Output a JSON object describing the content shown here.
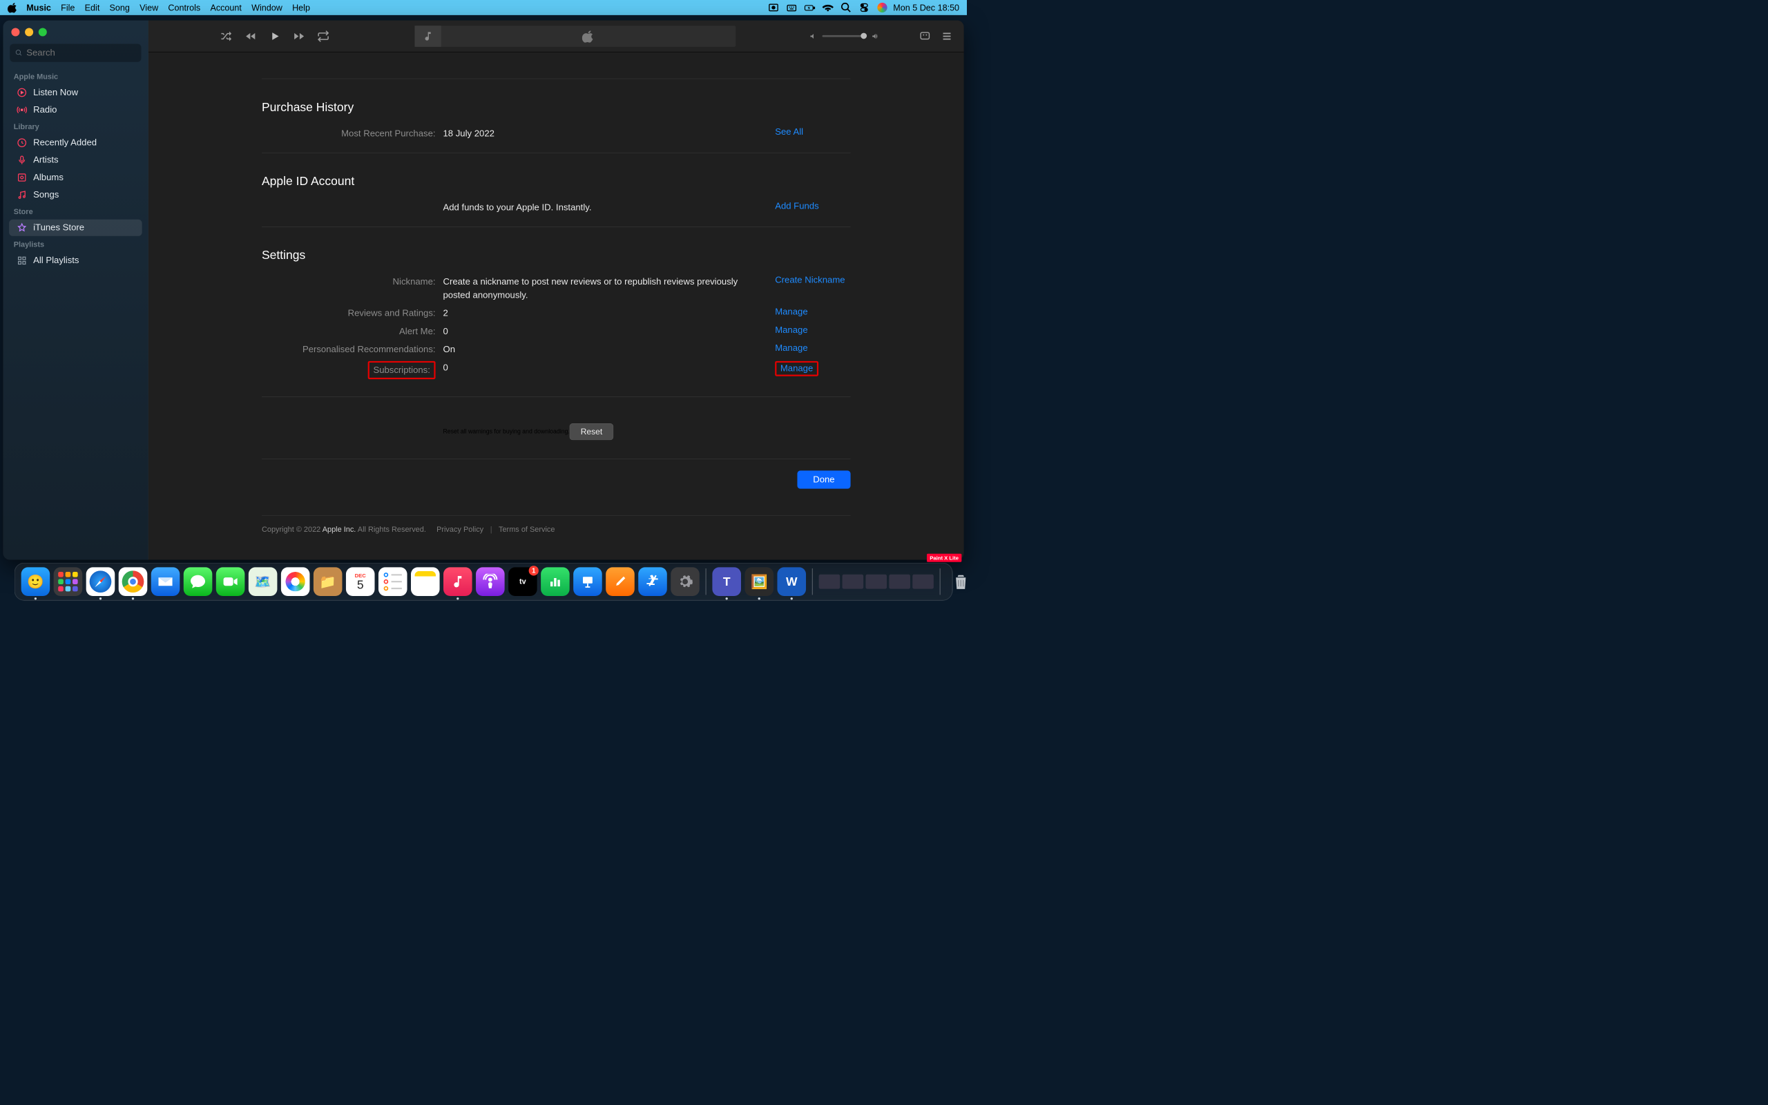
{
  "menubar": {
    "app": "Music",
    "items": [
      "File",
      "Edit",
      "Song",
      "View",
      "Controls",
      "Account",
      "Window",
      "Help"
    ],
    "datetime": "Mon 5 Dec  18:50"
  },
  "sidebar": {
    "search_placeholder": "Search",
    "sections": [
      {
        "heading": "Apple Music",
        "items": [
          {
            "label": "Listen Now",
            "icon": "play-circle",
            "tint": "pink"
          },
          {
            "label": "Radio",
            "icon": "broadcast",
            "tint": "red"
          }
        ]
      },
      {
        "heading": "Library",
        "items": [
          {
            "label": "Recently Added",
            "icon": "clock",
            "tint": "red"
          },
          {
            "label": "Artists",
            "icon": "mic",
            "tint": "red"
          },
          {
            "label": "Albums",
            "icon": "album",
            "tint": "red"
          },
          {
            "label": "Songs",
            "icon": "note",
            "tint": "red"
          }
        ]
      },
      {
        "heading": "Store",
        "items": [
          {
            "label": "iTunes Store",
            "icon": "star",
            "tint": "purple",
            "active": true
          }
        ]
      },
      {
        "heading": "Playlists",
        "items": [
          {
            "label": "All Playlists",
            "icon": "grid",
            "tint": "grey"
          }
        ]
      }
    ]
  },
  "account_page": {
    "purchase_history": {
      "title": "Purchase History",
      "label": "Most Recent Purchase:",
      "value": "18 July 2022",
      "see_all": "See All"
    },
    "apple_id": {
      "title": "Apple ID Account",
      "funds_text": "Add funds to your Apple ID. Instantly.",
      "add_funds": "Add Funds"
    },
    "settings": {
      "title": "Settings",
      "rows": [
        {
          "label": "Nickname:",
          "value": "Create a nickname to post new reviews or to republish reviews previously posted anonymously.",
          "action": "Create Nickname"
        },
        {
          "label": "Reviews and Ratings:",
          "value": "2",
          "action": "Manage"
        },
        {
          "label": "Alert Me:",
          "value": "0",
          "action": "Manage"
        },
        {
          "label": "Personalised Recommendations:",
          "value": "On",
          "action": "Manage"
        },
        {
          "label": "Subscriptions:",
          "value": "0",
          "action": "Manage",
          "highlight": true
        }
      ]
    },
    "reset": {
      "text": "Reset all warnings for buying and downloading.",
      "button": "Reset"
    },
    "done": "Done",
    "footer": {
      "copyright": "Copyright © 2022 ",
      "apple": "Apple Inc.",
      "rights": " All Rights Reserved.",
      "privacy": "Privacy Policy",
      "terms": "Terms of Service"
    }
  },
  "dock": {
    "calendar": {
      "month": "DEC",
      "day": "5"
    },
    "tv_badge": "1"
  },
  "overlay_badge": "Paint X Lite"
}
